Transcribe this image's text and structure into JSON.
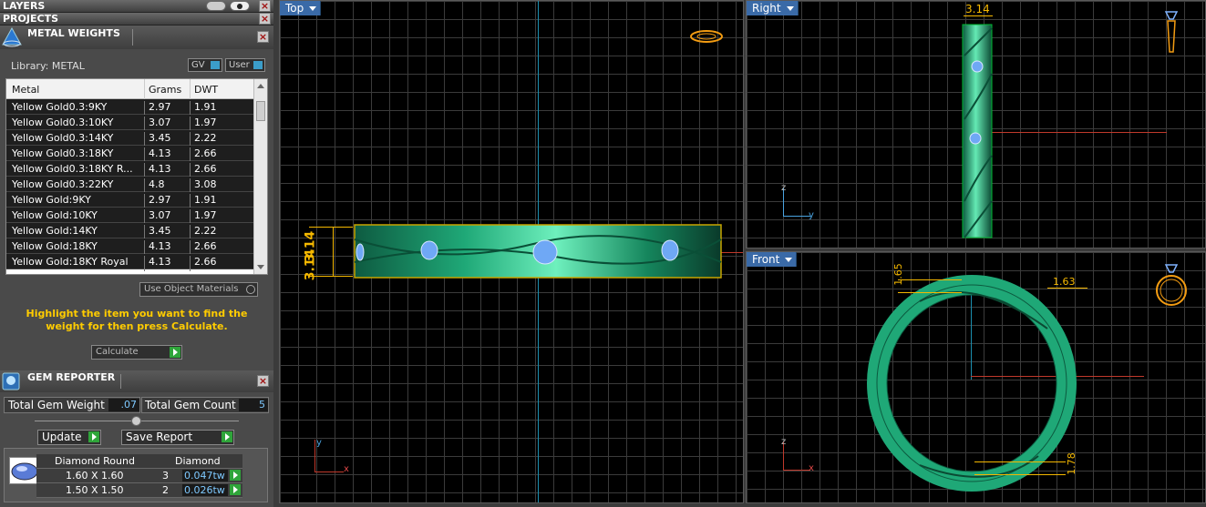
{
  "panels": {
    "layers": {
      "title": "LAYERS"
    },
    "projects": {
      "title": "PROJECTS"
    },
    "metal_weights": {
      "title": "METAL WEIGHTS",
      "library_label": "Library: METAL",
      "toggles": [
        "GV",
        "User"
      ],
      "columns": [
        "Metal",
        "Grams",
        "DWT"
      ],
      "rows": [
        {
          "metal": "Yellow Gold0.3:9KY",
          "grams": "2.97",
          "dwt": "1.91"
        },
        {
          "metal": "Yellow Gold0.3:10KY",
          "grams": "3.07",
          "dwt": "1.97"
        },
        {
          "metal": "Yellow Gold0.3:14KY",
          "grams": "3.45",
          "dwt": "2.22"
        },
        {
          "metal": "Yellow Gold0.3:18KY",
          "grams": "4.13",
          "dwt": "2.66"
        },
        {
          "metal": "Yellow Gold0.3:18KY R...",
          "grams": "4.13",
          "dwt": "2.66"
        },
        {
          "metal": "Yellow Gold0.3:22KY",
          "grams": "4.8",
          "dwt": "3.08"
        },
        {
          "metal": "Yellow Gold:9KY",
          "grams": "2.97",
          "dwt": "1.91"
        },
        {
          "metal": "Yellow Gold:10KY",
          "grams": "3.07",
          "dwt": "1.97"
        },
        {
          "metal": "Yellow Gold:14KY",
          "grams": "3.45",
          "dwt": "2.22"
        },
        {
          "metal": "Yellow Gold:18KY",
          "grams": "4.13",
          "dwt": "2.66"
        },
        {
          "metal": "Yellow Gold:18KY Royal",
          "grams": "4.13",
          "dwt": "2.66"
        }
      ],
      "use_object_materials": "Use Object Materials",
      "instruction": "Highlight the item you want to find the weight for then press Calculate.",
      "calculate_label": "Calculate"
    },
    "gem_reporter": {
      "title": "GEM REPORTER",
      "total_weight_label": "Total Gem Weight",
      "total_weight_value": ".07",
      "total_count_label": "Total Gem Count",
      "total_count_value": "5",
      "update_label": "Update",
      "save_report_label": "Save Report",
      "gem_columns": [
        "Diamond Round",
        "Diamond"
      ],
      "gems": [
        {
          "size": "1.60 X 1.60",
          "count": "3",
          "weight": "0.047tw"
        },
        {
          "size": "1.50 X 1.50",
          "count": "2",
          "weight": "0.026tw"
        }
      ]
    }
  },
  "viewports": {
    "top": {
      "label": "Top",
      "dim": "3.14",
      "axis_v": "y",
      "axis_h": "x"
    },
    "right": {
      "label": "Right",
      "dim": "3.14",
      "axis_v": "z",
      "axis_h": "y"
    },
    "front": {
      "label": "Front",
      "dim_a": "1.65",
      "dim_b": "1.63",
      "dim_c": "1.78",
      "axis_v": "z",
      "axis_h": "x"
    }
  },
  "colors": {
    "accent_tab": "#3a6aa7",
    "ring_green": "#1fa877",
    "dim_color": "#f5b800",
    "instruction": "#ffcc00"
  }
}
